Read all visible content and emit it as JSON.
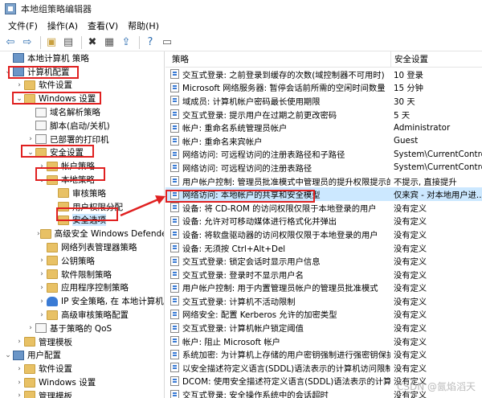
{
  "window": {
    "title": "本地组策略编辑器"
  },
  "menubar": [
    "文件(F)",
    "操作(A)",
    "查看(V)",
    "帮助(H)"
  ],
  "tree": [
    {
      "label": "本地计算机 策略",
      "level": 0,
      "exp": "",
      "icon": "computer"
    },
    {
      "label": "计算机配置",
      "level": 0,
      "exp": "⌄",
      "icon": "computer"
    },
    {
      "label": "软件设置",
      "level": 1,
      "exp": "›",
      "icon": "folder"
    },
    {
      "label": "Windows 设置",
      "level": 1,
      "exp": "⌄",
      "icon": "folder"
    },
    {
      "label": "域名解析策略",
      "level": 2,
      "exp": "",
      "icon": "doc"
    },
    {
      "label": "脚本(启动/关机)",
      "level": 2,
      "exp": "",
      "icon": "doc"
    },
    {
      "label": "已部署的打印机",
      "level": 2,
      "exp": "›",
      "icon": "doc"
    },
    {
      "label": "安全设置",
      "level": 2,
      "exp": "⌄",
      "icon": "folder"
    },
    {
      "label": "帐户策略",
      "level": 3,
      "exp": "›",
      "icon": "folder"
    },
    {
      "label": "本地策略",
      "level": 3,
      "exp": "⌄",
      "icon": "folder"
    },
    {
      "label": "审核策略",
      "level": 4,
      "exp": "",
      "icon": "folder"
    },
    {
      "label": "用户权限分配",
      "level": 4,
      "exp": "",
      "icon": "folder"
    },
    {
      "label": "安全选项",
      "level": 4,
      "exp": "",
      "icon": "folder",
      "selected": true
    },
    {
      "label": "高级安全 Windows Defende",
      "level": 3,
      "exp": "›",
      "icon": "folder"
    },
    {
      "label": "网络列表管理器策略",
      "level": 3,
      "exp": "",
      "icon": "folder"
    },
    {
      "label": "公钥策略",
      "level": 3,
      "exp": "›",
      "icon": "folder"
    },
    {
      "label": "软件限制策略",
      "level": 3,
      "exp": "›",
      "icon": "folder"
    },
    {
      "label": "应用程序控制策略",
      "level": 3,
      "exp": "›",
      "icon": "folder"
    },
    {
      "label": "IP 安全策略, 在 本地计算机",
      "level": 3,
      "exp": "›",
      "icon": "shield"
    },
    {
      "label": "高级审核策略配置",
      "level": 3,
      "exp": "›",
      "icon": "folder"
    },
    {
      "label": "基于策略的 QoS",
      "level": 2,
      "exp": "›",
      "icon": "doc"
    },
    {
      "label": "管理模板",
      "level": 1,
      "exp": "›",
      "icon": "folder"
    },
    {
      "label": "用户配置",
      "level": 0,
      "exp": "⌄",
      "icon": "computer"
    },
    {
      "label": "软件设置",
      "level": 1,
      "exp": "›",
      "icon": "folder"
    },
    {
      "label": "Windows 设置",
      "level": 1,
      "exp": "›",
      "icon": "folder"
    },
    {
      "label": "管理模板",
      "level": 1,
      "exp": "›",
      "icon": "folder"
    }
  ],
  "list": {
    "headers": {
      "policy": "策略",
      "setting": "安全设置"
    },
    "rows": [
      {
        "policy": "交互式登录: 之前登录到缓存的次数(域控制器不可用时)",
        "setting": "10 登录"
      },
      {
        "policy": "Microsoft 网络服务器: 暂停会话前所需的空闲时间数量",
        "setting": "15 分钟"
      },
      {
        "policy": "域成员: 计算机帐户密码最长使用期限",
        "setting": "30 天"
      },
      {
        "policy": "交互式登录: 提示用户在过期之前更改密码",
        "setting": "5 天"
      },
      {
        "policy": "帐户: 重命名系统管理员帐户",
        "setting": "Administrator"
      },
      {
        "policy": "帐户: 重命名来宾帐户",
        "setting": "Guest"
      },
      {
        "policy": "网络访问: 可远程访问的注册表路径和子路径",
        "setting": "System\\CurrentContro..."
      },
      {
        "policy": "网络访问: 可远程访问的注册表路径",
        "setting": "System\\CurrentContro..."
      },
      {
        "policy": "用户帐户控制: 管理员批准模式中管理员的提升权限提示的...",
        "setting": "不提示, 直接提升"
      },
      {
        "policy": "网络访问: 本地帐户的共享和安全模型",
        "setting": "仅来宾 - 对本地用户进...",
        "selected": true
      },
      {
        "policy": "设备: 将 CD-ROM 的访问权限仅限于本地登录的用户",
        "setting": "没有定义"
      },
      {
        "policy": "设备: 允许对可移动媒体进行格式化并弹出",
        "setting": "没有定义"
      },
      {
        "policy": "设备: 将软盘驱动器的访问权限仅限于本地登录的用户",
        "setting": "没有定义"
      },
      {
        "policy": "设备: 无须按 Ctrl+Alt+Del",
        "setting": "没有定义"
      },
      {
        "policy": "交互式登录: 锁定会话时显示用户信息",
        "setting": "没有定义"
      },
      {
        "policy": "交互式登录: 登录时不显示用户名",
        "setting": "没有定义"
      },
      {
        "policy": "用户帐户控制: 用于内置管理员帐户的管理员批准模式",
        "setting": "没有定义"
      },
      {
        "policy": "交互式登录: 计算机不活动限制",
        "setting": "没有定义"
      },
      {
        "policy": "网络安全: 配置 Kerberos 允许的加密类型",
        "setting": "没有定义"
      },
      {
        "policy": "交互式登录: 计算机帐户锁定阈值",
        "setting": "没有定义"
      },
      {
        "policy": "帐户: 阻止 Microsoft 帐户",
        "setting": "没有定义"
      },
      {
        "policy": "系统加密: 为计算机上存储的用户密钥强制进行强密钥保护",
        "setting": "没有定义"
      },
      {
        "policy": "以安全描述符定义语言(SDDL)语法表示的计算机访问限制",
        "setting": "没有定义"
      },
      {
        "policy": "DCOM: 使用安全描述符定义语言(SDDL)语法表示的计算机启动...",
        "setting": "没有定义"
      },
      {
        "policy": "交互式登录: 安全操作系统中的会话超时",
        "setting": "没有定义"
      }
    ]
  },
  "watermark": "CSDN @氤焰滔天",
  "colors": {
    "accent": "#cce8ff",
    "highlight_box": "#e02020"
  }
}
